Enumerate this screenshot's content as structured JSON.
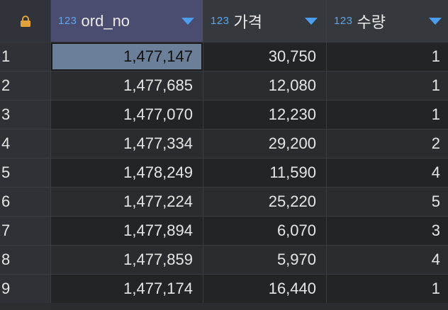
{
  "header": {
    "columns": [
      {
        "type_badge": "123",
        "label": "ord_no"
      },
      {
        "type_badge": "123",
        "label": "가격"
      },
      {
        "type_badge": "123",
        "label": "수량"
      }
    ]
  },
  "rows": [
    {
      "num": "1",
      "ord_no": "1,477,147",
      "price": "30,750",
      "qty": "1"
    },
    {
      "num": "2",
      "ord_no": "1,477,685",
      "price": "12,080",
      "qty": "1"
    },
    {
      "num": "3",
      "ord_no": "1,477,070",
      "price": "12,230",
      "qty": "1"
    },
    {
      "num": "4",
      "ord_no": "1,477,334",
      "price": "29,200",
      "qty": "2"
    },
    {
      "num": "5",
      "ord_no": "1,478,249",
      "price": "11,590",
      "qty": "4"
    },
    {
      "num": "6",
      "ord_no": "1,477,224",
      "price": "25,220",
      "qty": "5"
    },
    {
      "num": "7",
      "ord_no": "1,477,894",
      "price": "6,070",
      "qty": "3"
    },
    {
      "num": "8",
      "ord_no": "1,477,859",
      "price": "5,970",
      "qty": "4"
    },
    {
      "num": "9",
      "ord_no": "1,477,174",
      "price": "16,440",
      "qty": "1"
    }
  ],
  "colors": {
    "accent": "#4c9ef0",
    "lock": "#e2a23b",
    "selected_cell": "#6c7f99",
    "active_header": "#4a4d70"
  },
  "icons": {
    "corner": "lock-icon",
    "sort": "chevron-down-icon"
  }
}
